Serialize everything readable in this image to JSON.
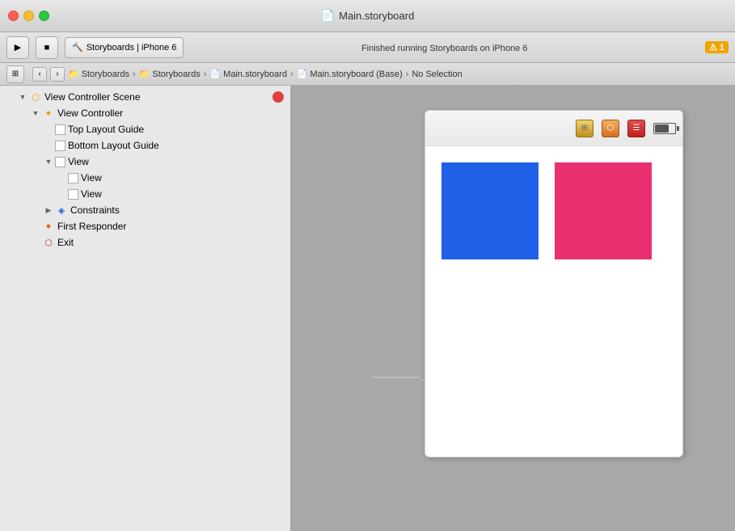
{
  "titleBar": {
    "title": "Main.storyboard",
    "icon": "📄"
  },
  "toolbar": {
    "playLabel": "▶",
    "stopLabel": "■",
    "schemeLabel": "Storyboards  |  iPhone 6",
    "statusMessage": "Finished running Storyboards on iPhone 6",
    "warningCount": "1"
  },
  "breadcrumb": {
    "back": "‹",
    "forward": "›",
    "items": [
      {
        "label": "Storyboards",
        "icon": "📁"
      },
      {
        "label": "Storyboards",
        "icon": "📁"
      },
      {
        "label": "Main.storyboard",
        "icon": "📄"
      },
      {
        "label": "Main.storyboard (Base)",
        "icon": "📄"
      },
      {
        "label": "No Selection"
      }
    ]
  },
  "navigator": {
    "items": [
      {
        "indent": 1,
        "arrow": "open",
        "icon": "📦",
        "iconClass": "icon-yellow",
        "label": "View Controller Scene",
        "badge": true
      },
      {
        "indent": 2,
        "arrow": "open",
        "icon": "●",
        "iconClass": "icon-yellow",
        "label": "View Controller"
      },
      {
        "indent": 3,
        "arrow": "empty",
        "icon": "☐",
        "iconClass": "icon-gray",
        "label": "Top Layout Guide"
      },
      {
        "indent": 3,
        "arrow": "empty",
        "icon": "☐",
        "iconClass": "icon-gray",
        "label": "Bottom Layout Guide"
      },
      {
        "indent": 3,
        "arrow": "open",
        "icon": "☐",
        "iconClass": "icon-gray",
        "label": "View"
      },
      {
        "indent": 4,
        "arrow": "empty",
        "icon": "☐",
        "iconClass": "icon-gray",
        "label": "View"
      },
      {
        "indent": 4,
        "arrow": "empty",
        "icon": "☐",
        "iconClass": "icon-gray",
        "label": "View"
      },
      {
        "indent": 3,
        "arrow": "closed",
        "icon": "◈",
        "iconClass": "icon-blue",
        "label": "Constraints"
      },
      {
        "indent": 2,
        "arrow": "empty",
        "icon": "●",
        "iconClass": "icon-orange",
        "label": "First Responder"
      },
      {
        "indent": 2,
        "arrow": "empty",
        "icon": "⬡",
        "iconClass": "icon-red",
        "label": "Exit"
      }
    ]
  },
  "canvas": {
    "arrowLabel": "→",
    "iphone": {
      "icons": [
        "📅",
        "📦",
        "📋"
      ],
      "blueSquare": "#2060e8",
      "pinkSquare": "#e83070"
    }
  }
}
